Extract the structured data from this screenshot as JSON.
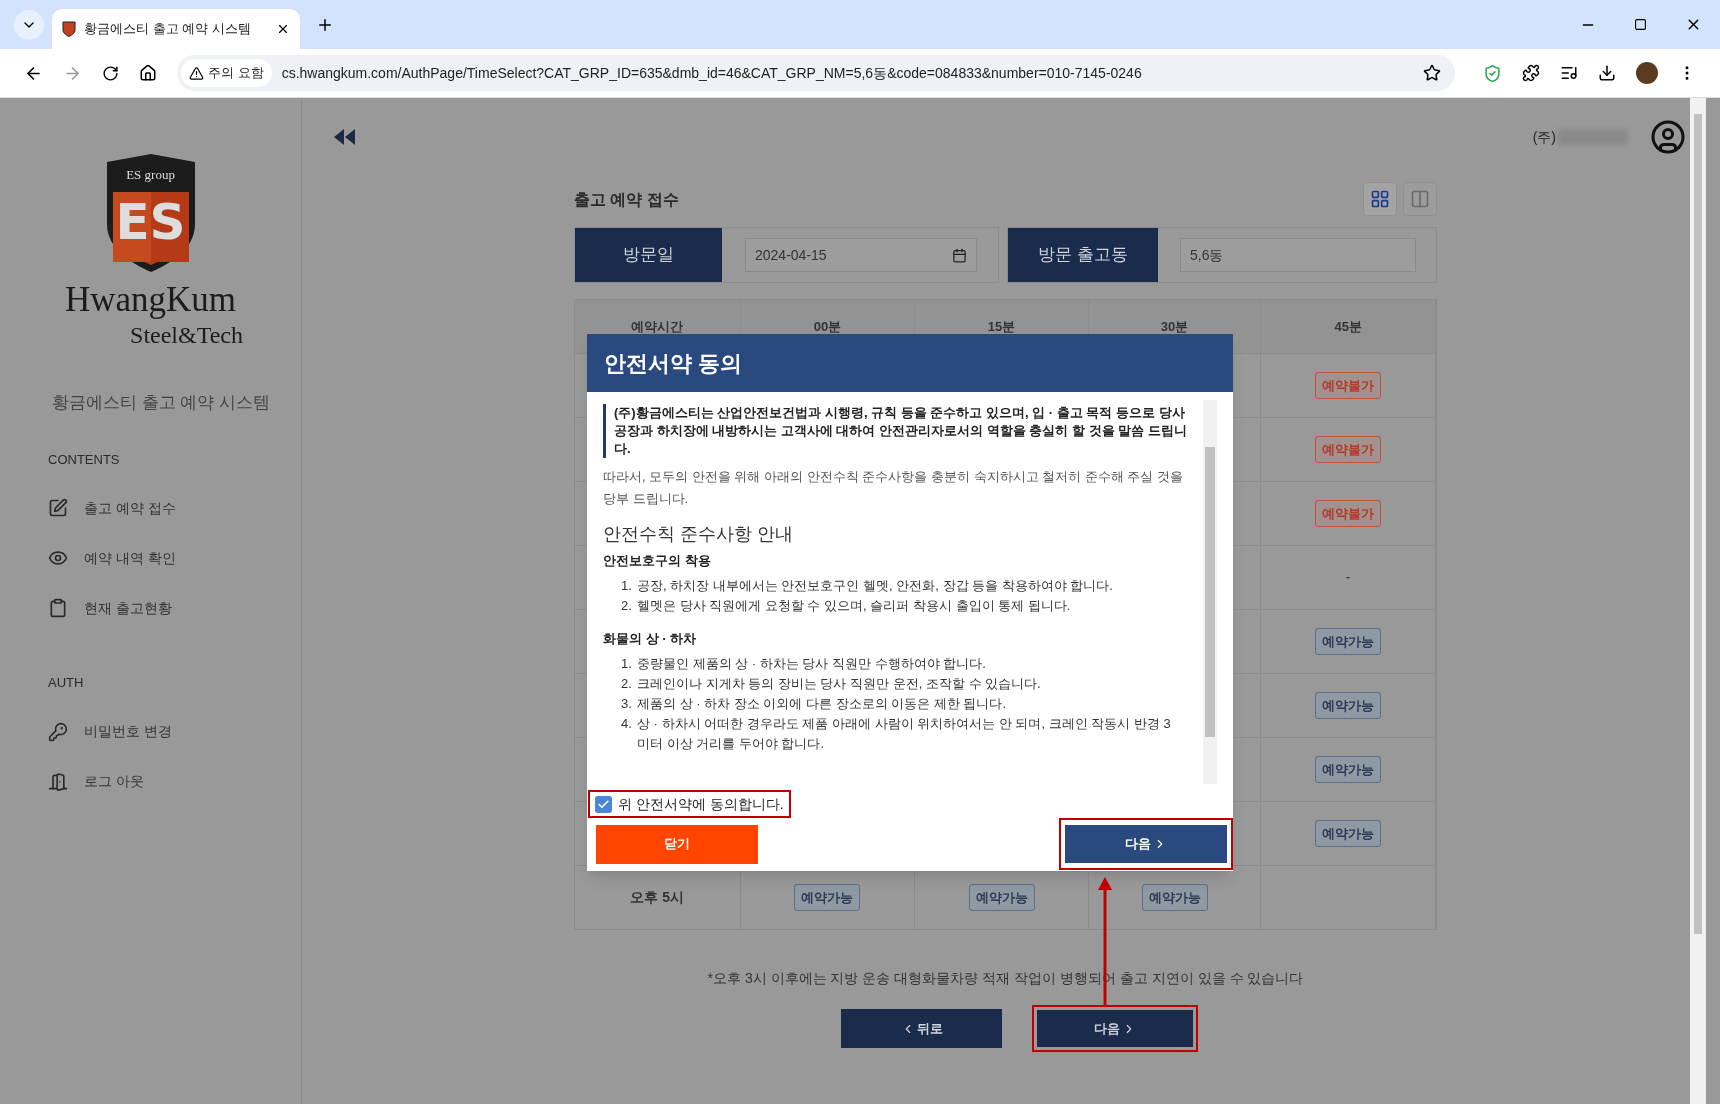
{
  "browser": {
    "tab_title": "황금에스티 출고 예약 시스템",
    "address_warning": "주의 요함",
    "url": "cs.hwangkum.com/AuthPage/TimeSelect?CAT_GRP_ID=635&dmb_id=46&CAT_GRP_NM=5,6동&code=084833&number=010-7145-0246"
  },
  "sidebar": {
    "logo": {
      "badge": "ES group",
      "letters": "ES",
      "name": "HwangKum",
      "tagline": "Steel&Tech"
    },
    "system_name": "황금에스티 출고 예약 시스템",
    "sections": [
      {
        "heading": "CONTENTS",
        "items": [
          {
            "kind": "edit",
            "label": "출고 예약 접수"
          },
          {
            "kind": "view",
            "label": "예약 내역 확인"
          },
          {
            "kind": "status",
            "label": "현재 출고현황"
          }
        ]
      },
      {
        "heading": "AUTH",
        "items": [
          {
            "kind": "password",
            "label": "비밀번호 변경"
          },
          {
            "kind": "logout",
            "label": "로그 아웃"
          }
        ]
      }
    ]
  },
  "header": {
    "company_prefix": "(주)"
  },
  "form": {
    "title": "출고 예약 접수",
    "view_modes": [
      {
        "kind": "grid",
        "selected": true
      },
      {
        "kind": "columns",
        "selected": false
      }
    ],
    "visit_date_label": "방문일",
    "visit_date": "2024-04-15",
    "dock_label": "방문 출고동",
    "dock": "5,6동"
  },
  "table": {
    "columns": [
      "예약시간",
      "00분",
      "15분",
      "30분",
      "45분"
    ],
    "rows": [
      {
        "m45": {
          "kind": "unavailable",
          "label": "예약불가"
        }
      },
      {
        "m45": {
          "kind": "unavailable",
          "label": "예약불가"
        }
      },
      {
        "m45": {
          "kind": "unavailable",
          "label": "예약불가"
        }
      },
      {
        "m45": {
          "kind": "none",
          "label": "-"
        }
      },
      {
        "m45": {
          "kind": "available",
          "label": "예약가능"
        }
      },
      {
        "m45": {
          "kind": "available",
          "label": "예약가능"
        }
      },
      {
        "m45": {
          "kind": "available",
          "label": "예약가능"
        }
      },
      {
        "m45": {
          "kind": "available",
          "label": "예약가능"
        }
      },
      {
        "time": "오후 5시",
        "m00": {
          "kind": "available",
          "label": "예약가능"
        },
        "m15": {
          "kind": "available",
          "label": "예약가능"
        },
        "m30": {
          "kind": "available",
          "label": "예약가능"
        }
      }
    ]
  },
  "note": "*오후 3시 이후에는 지방 운송 대형화물차량 적재 작업이 병행되어 출고 지연이 있을 수 있습니다",
  "buttons": {
    "back": "뒤로",
    "next": "다음"
  },
  "modal": {
    "title": "안전서약 동의",
    "notice": "(주)황금에스티는 산업안전보건법과 시행령, 규칙 등을 준수하고 있으며, 입 · 출고 목적 등으로 당사 공장과 하치장에 내방하시는 고객사에 대하여 안전관리자로서의 역할을 충실히 할 것을 말씀 드립니다.",
    "intro": "따라서, 모두의 안전을 위해 아래의 안전수칙 준수사항을 충분히 숙지하시고 철저히 준수해 주실 것을 당부 드립니다.",
    "heading": "안전수칙 준수사항 안내",
    "sections": [
      {
        "heading": "안전보호구의 착용",
        "items": [
          {
            "number": "1.",
            "text": "공장, 하치장 내부에서는 안전보호구인 헬멧, 안전화, 장갑 등을 착용하여야 합니다."
          },
          {
            "number": "2.",
            "text": "헬멧은 당사 직원에게 요청할 수 있으며, 슬리퍼 착용시 출입이 통제 됩니다."
          }
        ]
      },
      {
        "heading": "화물의 상 · 하차",
        "items": [
          {
            "number": "1.",
            "text": "중량물인 제품의 상 · 하차는 당사 직원만 수행하여야 합니다."
          },
          {
            "number": "2.",
            "text": "크레인이나 지게차 등의 장비는 당사 직원만 운전, 조작할 수 있습니다."
          },
          {
            "number": "3.",
            "text": "제품의 상 · 하차 장소 이외에 다른 장소로의 이동은 제한 됩니다."
          },
          {
            "number": "4.",
            "text": "상 · 하차시 어떠한 경우라도 제품 아래에 사람이 위치하여서는 안 되며, 크레인 작동시 반경 3 미터 이상 거리를 두어야 합니다."
          }
        ]
      }
    ],
    "agreement": {
      "label": "위 안전서약에 동의합니다.",
      "checked": true
    },
    "close": "닫기",
    "next": "다음"
  }
}
